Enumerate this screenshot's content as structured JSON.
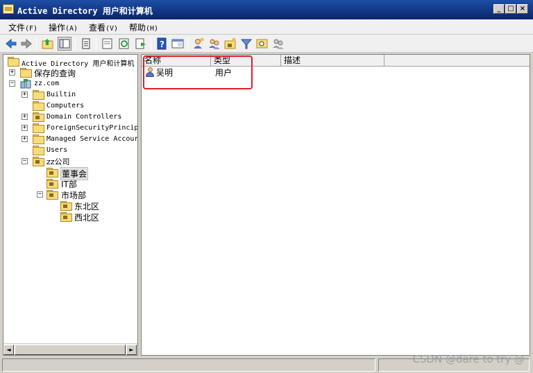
{
  "window": {
    "title": "Active Directory 用户和计算机",
    "minimize_label": "_",
    "maximize_label": "□",
    "close_label": "×"
  },
  "menu": [
    {
      "label": "文件",
      "accel": "(F)"
    },
    {
      "label": "操作",
      "accel": "(A)"
    },
    {
      "label": "查看",
      "accel": "(V)"
    },
    {
      "label": "帮助",
      "accel": "(H)"
    }
  ],
  "toolbar_icons": [
    "back-arrow-icon",
    "forward-arrow-icon",
    "up-folder-icon",
    "show-hide-tree-icon",
    "copy-icon",
    "properties-icon",
    "refresh-icon",
    "export-list-icon",
    "help-icon",
    "console-pane-icon",
    "new-user-icon",
    "new-group-icon",
    "new-ou-icon",
    "filter-icon",
    "find-icon",
    "add-to-group-icon"
  ],
  "tree": {
    "root": "Active Directory 用户和计算机",
    "saved_queries": "保存的查询",
    "domain": "zz.com",
    "children": [
      {
        "label": "Builtin"
      },
      {
        "label": "Computers"
      },
      {
        "label": "Domain Controllers"
      },
      {
        "label": "ForeignSecurityPrincip"
      },
      {
        "label": "Managed Service Accour"
      },
      {
        "label": "Users"
      }
    ],
    "company": "zz公司",
    "company_children": [
      {
        "label": "董事会"
      },
      {
        "label": "IT部"
      },
      {
        "label": "市场部"
      }
    ],
    "market_children": [
      {
        "label": "东北区"
      },
      {
        "label": "西北区"
      }
    ],
    "expand": "+",
    "collapse": "−"
  },
  "list": {
    "columns": [
      "名称",
      "类型",
      "描述"
    ],
    "rows": [
      {
        "name": "吴明",
        "type": "用户",
        "description": ""
      }
    ]
  },
  "scroll": {
    "left": "◄",
    "right": "►"
  },
  "watermark": "CSDN @dare to try @",
  "colors": {
    "highlight": "#e31b23",
    "titlebar": "#0a246a"
  }
}
